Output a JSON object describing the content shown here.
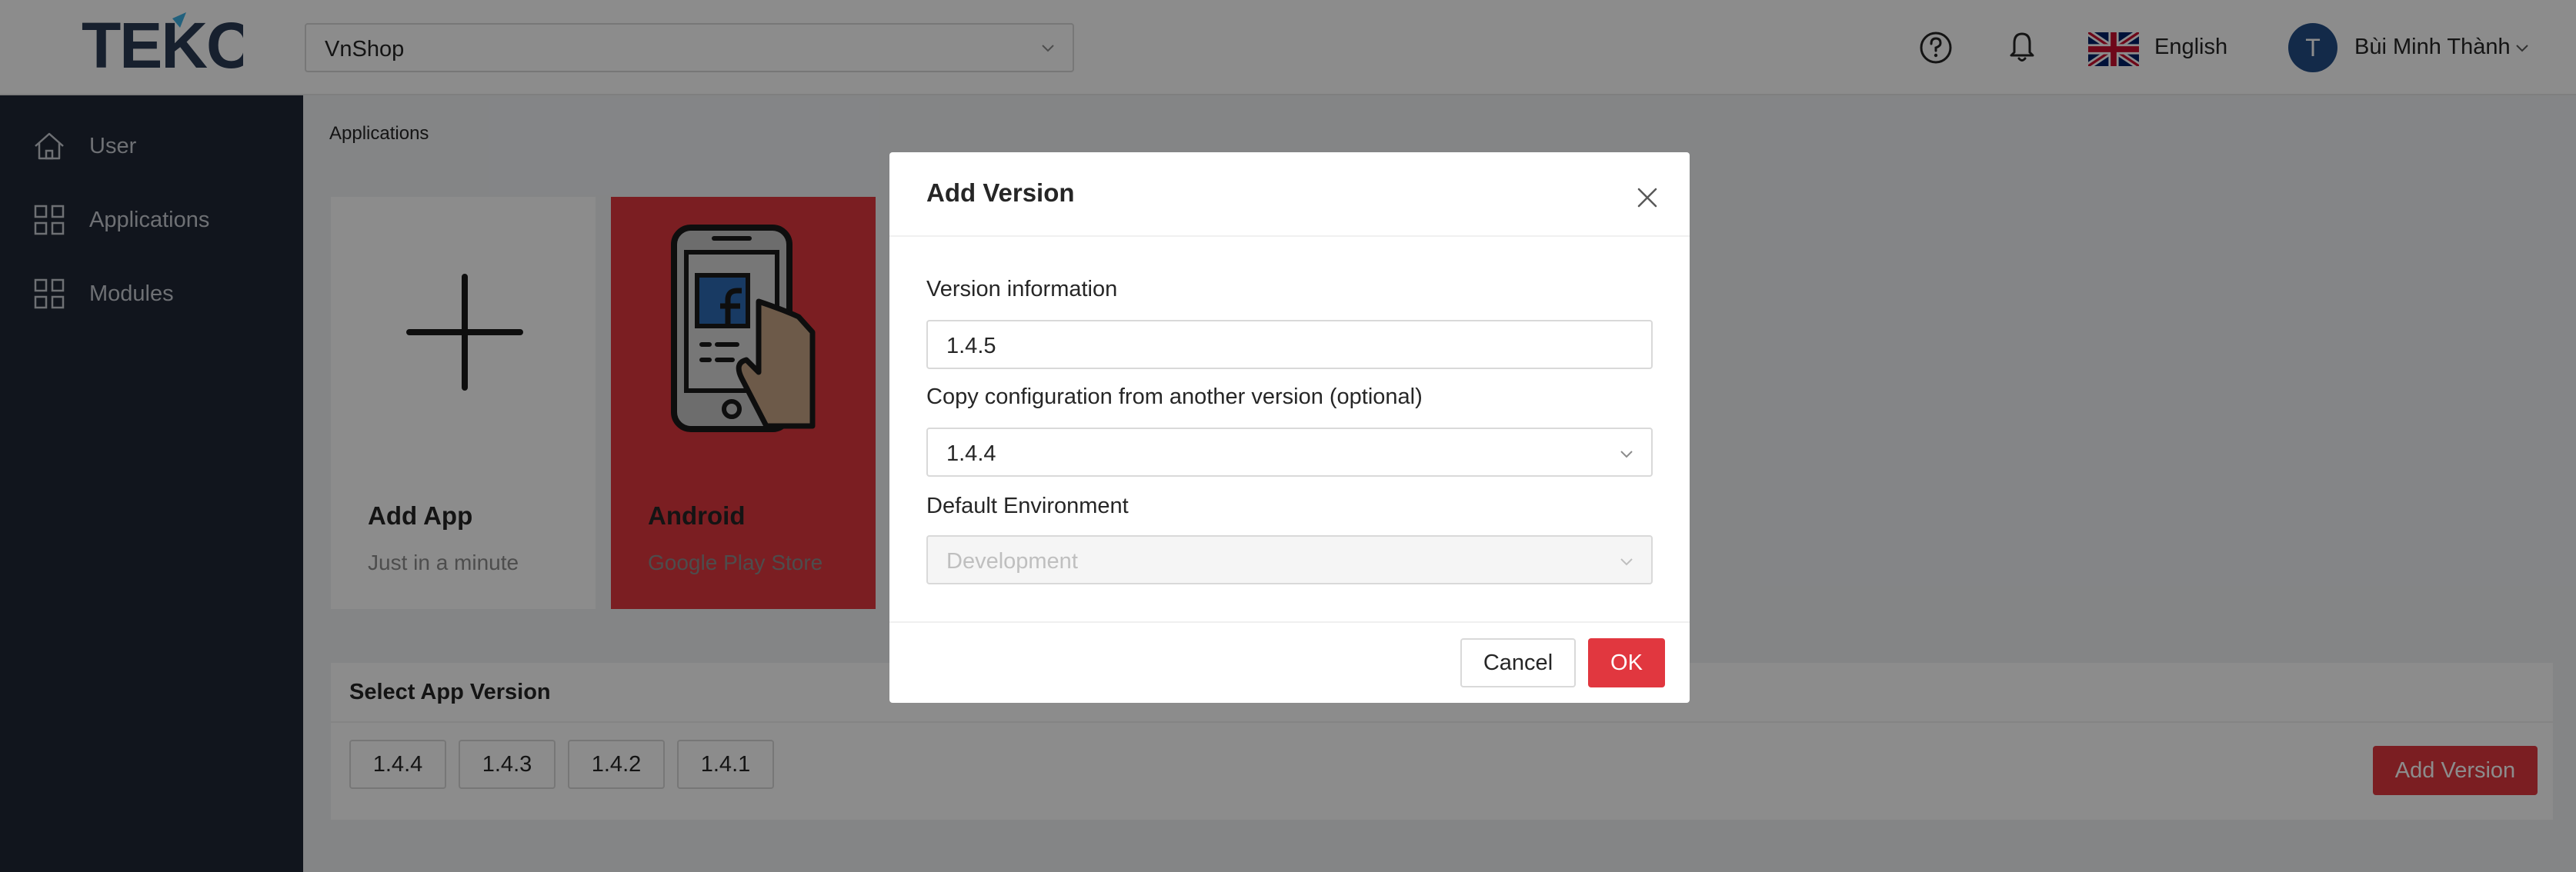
{
  "header": {
    "logo_text": "TEKO",
    "shop_select_value": "VnShop",
    "language_label": "English",
    "avatar_initial": "T",
    "user_name": "Bùi Minh Thành"
  },
  "sidebar": {
    "items": [
      {
        "label": "User",
        "icon": "home-icon"
      },
      {
        "label": "Applications",
        "icon": "grid-icon"
      },
      {
        "label": "Modules",
        "icon": "grid-icon"
      }
    ]
  },
  "main": {
    "breadcrumb": "Applications",
    "cards": [
      {
        "title": "Add App",
        "subtitle": "Just in a minute",
        "icon": "plus-icon"
      },
      {
        "title": "Android",
        "subtitle": "Google Play Store",
        "icon": "phone-icon"
      }
    ],
    "version_panel": {
      "title": "Select App Version",
      "versions": [
        "1.4.4",
        "1.4.3",
        "1.4.2",
        "1.4.1"
      ],
      "add_button": "Add Version"
    }
  },
  "modal": {
    "title": "Add Version",
    "fields": [
      {
        "label": "Version information",
        "value": "1.4.5"
      },
      {
        "label": "Copy configuration from another version (optional)",
        "value": "1.4.4"
      },
      {
        "label": "Default Environment",
        "value": "Development"
      }
    ],
    "cancel_label": "Cancel",
    "ok_label": "OK"
  },
  "colors": {
    "brand_red": "#e1373f",
    "sidebar_bg": "#1f2735",
    "avatar_bg": "#234e86"
  }
}
